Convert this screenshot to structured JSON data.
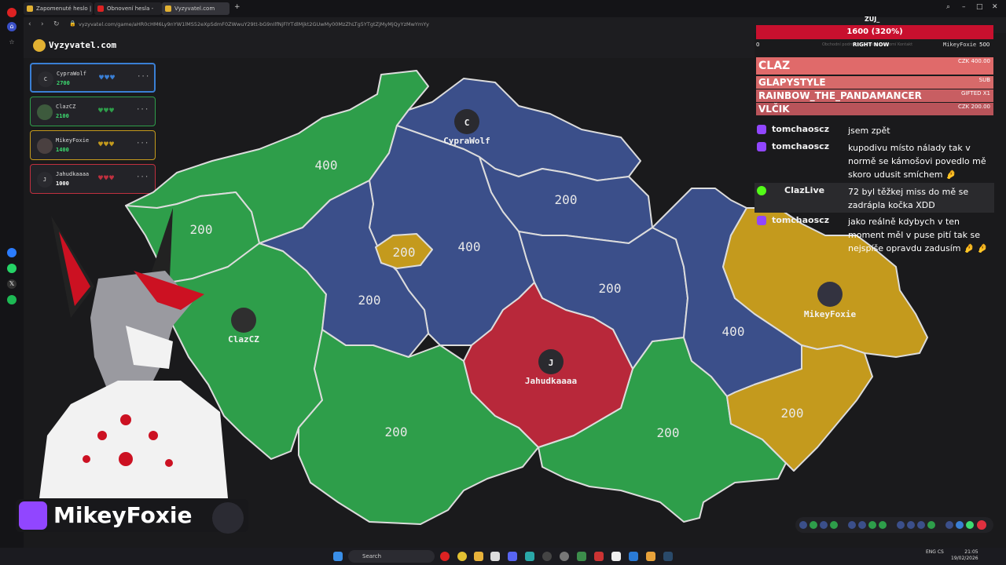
{
  "browser": {
    "tabs": [
      {
        "label": "Zapomenuté heslo | Vyzy",
        "color": "#e2b132"
      },
      {
        "label": "Obnovení hesla - foxiemi",
        "color": "#d22"
      },
      {
        "label": "Vyzyvatel.com",
        "color": "#e2b132"
      }
    ],
    "url": "vyzyvatel.com/game/aHR0cHM6Ly9nYW1lMS52eXpSdmF0ZWwuY29tt-bG9nIlfNjFlYTdlMjkt2GUwMy00MzZhLTg5YTgtZjMyMjQyYzMwYmYy"
  },
  "site": {
    "name": "Vyzyvatel.com"
  },
  "players": [
    {
      "initial": "C",
      "name": "CypraWolf",
      "score": "2700",
      "hearts": "♥♥♥",
      "color": "#3a7fd5"
    },
    {
      "initial": "",
      "name": "ClazCZ",
      "score": "2100",
      "hearts": "♥♥♥",
      "color": "#2e9e4a"
    },
    {
      "initial": "",
      "name": "MikeyFoxie",
      "score": "1400",
      "hearts": "♥♥♥",
      "color": "#c49a1d"
    },
    {
      "initial": "J",
      "name": "Jahudkaaaa",
      "score": "1000",
      "hearts": "♥♥♥",
      "color": "#c0303f"
    }
  ],
  "player_more": "···",
  "map": {
    "labels": [
      "400",
      "200",
      "200",
      "400",
      "200",
      "200",
      "200",
      "400",
      "200",
      "200",
      "200"
    ],
    "player_markers": [
      {
        "initial": "C",
        "name": "CypraWolf"
      },
      {
        "initial": "",
        "name": "ClazCZ"
      },
      {
        "initial": "J",
        "name": "Jahudkaaaa"
      },
      {
        "initial": "",
        "name": "MikeyFoxie"
      }
    ],
    "colors": {
      "green": "#2e9e4a",
      "blue": "#3b4f8a",
      "gold": "#c49a1d",
      "red": "#b8283a"
    }
  },
  "donation": {
    "top_label": "ZUJ_",
    "bar_text": "1600 (320%)",
    "left": "0",
    "mid": "RIGHT NOW",
    "right": "500"
  },
  "site_nav": {
    "links": "Obchodní podmínky   Zásady soukromí   Kontakt",
    "user": "MikeyFoxie"
  },
  "supporters": [
    {
      "name": "CLAZ",
      "amount": "CZK 400.00"
    },
    {
      "name": "GLAPYSTYLE",
      "amount": "SUB"
    },
    {
      "name": "RAINBOW_THE_PANDAMANCER",
      "amount": "GIFTED X1"
    },
    {
      "name": "VLČIK",
      "amount": "CZK 200.00"
    }
  ],
  "chat": [
    {
      "platform": "twitch",
      "user": "tomchaoscz",
      "text": "jsem zpět"
    },
    {
      "platform": "twitch",
      "user": "tomchaoscz",
      "text": "kupodivu místo nálady tak v normě se kámošovi povedlo mě skoro udusit smíchem 🤌"
    },
    {
      "platform": "kick",
      "user": "ClazLive",
      "text": "72 byl těžkej miss do mě se zadrápla kočka XDD"
    },
    {
      "platform": "twitch",
      "user": "tomchaoscz",
      "text": "jako reálně kdybych v ten moment měl v puse pití tak se nejspíše opravdu zadusím 🤌 🤌"
    }
  ],
  "streamer": {
    "name": "MikeyFoxie"
  },
  "taskbar": {
    "search": "Search",
    "lang": "ENG\nCS",
    "time": "21:05",
    "date": "19/02/2026"
  }
}
